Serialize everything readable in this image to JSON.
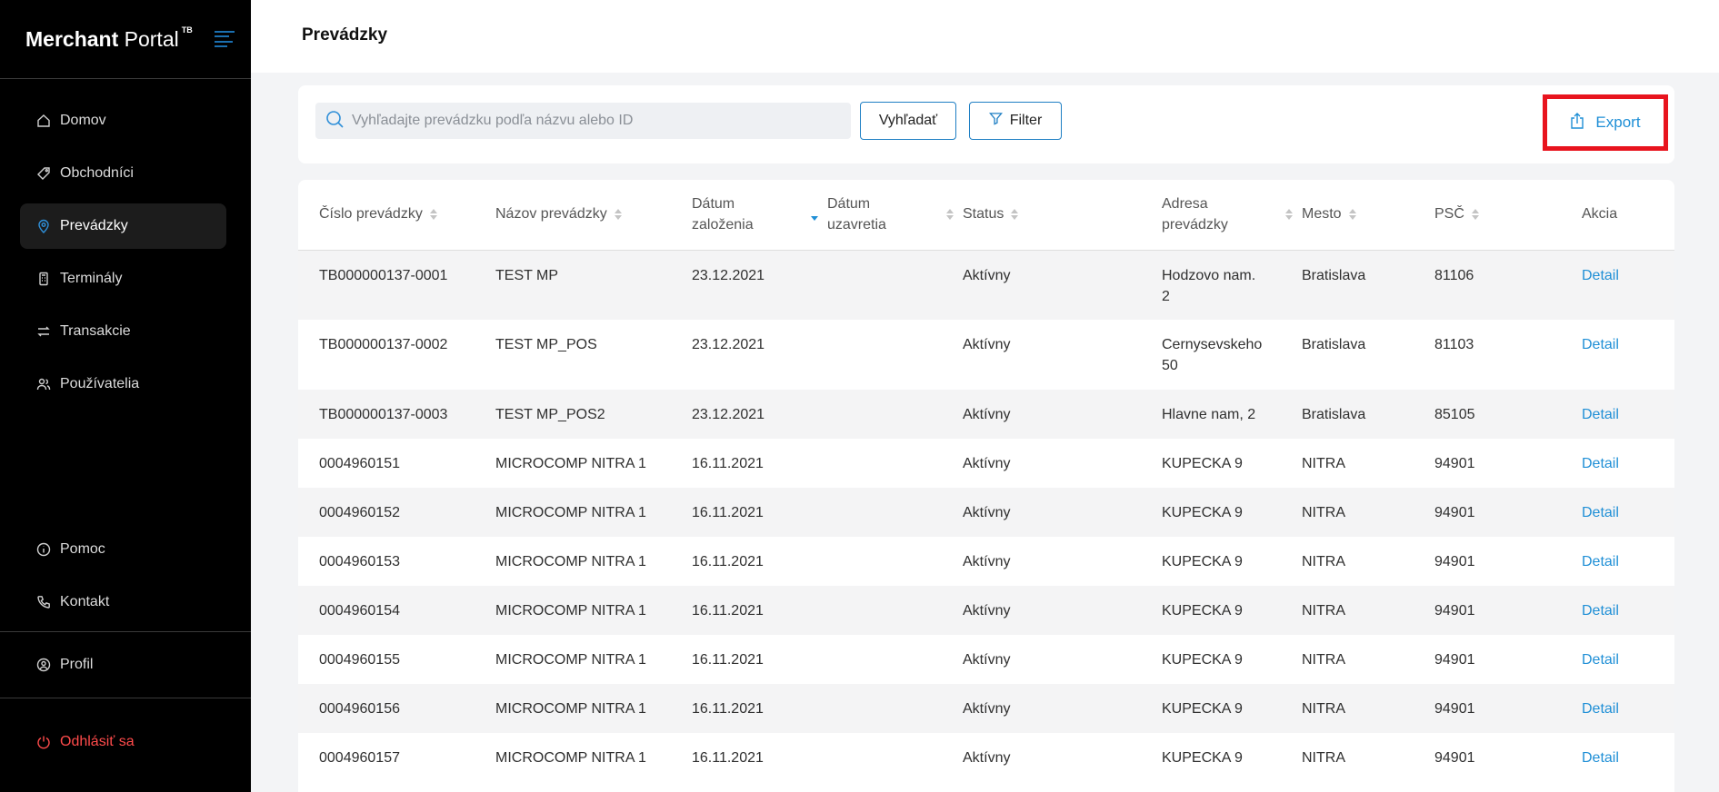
{
  "brand": {
    "bold": "Merchant",
    "rest": "Portal",
    "sup": "TB"
  },
  "nav": {
    "items": [
      {
        "label": "Domov",
        "icon": "home-icon"
      },
      {
        "label": "Obchodníci",
        "icon": "tag-icon"
      },
      {
        "label": "Prevádzky",
        "icon": "location-pin-icon",
        "active": true
      },
      {
        "label": "Terminály",
        "icon": "terminal-icon"
      },
      {
        "label": "Transakcie",
        "icon": "transfer-arrows-icon"
      },
      {
        "label": "Používatelia",
        "icon": "users-icon"
      }
    ],
    "help": "Pomoc",
    "contact": "Kontakt",
    "profile": "Profil",
    "logout": "Odhlásiť sa"
  },
  "page": {
    "title": "Prevádzky"
  },
  "search": {
    "placeholder": "Vyhľadajte prevádzku podľa názvu alebo ID",
    "value": "",
    "search_label": "Vyhľadať",
    "filter_label": "Filter",
    "export_label": "Export"
  },
  "table": {
    "headers": [
      {
        "l1": "Číslo prevádzky",
        "l2": ""
      },
      {
        "l1": "Názov prevádzky",
        "l2": ""
      },
      {
        "l1": "Dátum",
        "l2": "založenia"
      },
      {
        "l1": "Dátum",
        "l2": "uzavretia"
      },
      {
        "l1": "Status",
        "l2": ""
      },
      {
        "l1": "Adresa",
        "l2": "prevádzky"
      },
      {
        "l1": "Mesto",
        "l2": ""
      },
      {
        "l1": "PSČ",
        "l2": ""
      },
      {
        "l1": "Akcia",
        "l2": ""
      }
    ],
    "rows": [
      {
        "id": "TB000000137-0001",
        "name": "TEST MP",
        "created": "23.12.2021",
        "closed": "",
        "status": "Aktívny",
        "addr1": "Hodzovo nam.",
        "addr2": "2",
        "city": "Bratislava",
        "zip": "81106",
        "action": "Detail"
      },
      {
        "id": "TB000000137-0002",
        "name": "TEST MP_POS",
        "created": "23.12.2021",
        "closed": "",
        "status": "Aktívny",
        "addr1": "Cernysevskeho",
        "addr2": "50",
        "city": "Bratislava",
        "zip": "81103",
        "action": "Detail"
      },
      {
        "id": "TB000000137-0003",
        "name": "TEST MP_POS2",
        "created": "23.12.2021",
        "closed": "",
        "status": "Aktívny",
        "addr1": "Hlavne nam, 2",
        "addr2": "",
        "city": "Bratislava",
        "zip": "85105",
        "action": "Detail"
      },
      {
        "id": "0004960151",
        "name": "MICROCOMP NITRA 1",
        "created": "16.11.2021",
        "closed": "",
        "status": "Aktívny",
        "addr1": "KUPECKA 9",
        "addr2": "",
        "city": "NITRA",
        "zip": "94901",
        "action": "Detail"
      },
      {
        "id": "0004960152",
        "name": "MICROCOMP NITRA 1",
        "created": "16.11.2021",
        "closed": "",
        "status": "Aktívny",
        "addr1": "KUPECKA 9",
        "addr2": "",
        "city": "NITRA",
        "zip": "94901",
        "action": "Detail"
      },
      {
        "id": "0004960153",
        "name": "MICROCOMP NITRA 1",
        "created": "16.11.2021",
        "closed": "",
        "status": "Aktívny",
        "addr1": "KUPECKA 9",
        "addr2": "",
        "city": "NITRA",
        "zip": "94901",
        "action": "Detail"
      },
      {
        "id": "0004960154",
        "name": "MICROCOMP NITRA 1",
        "created": "16.11.2021",
        "closed": "",
        "status": "Aktívny",
        "addr1": "KUPECKA 9",
        "addr2": "",
        "city": "NITRA",
        "zip": "94901",
        "action": "Detail"
      },
      {
        "id": "0004960155",
        "name": "MICROCOMP NITRA 1",
        "created": "16.11.2021",
        "closed": "",
        "status": "Aktívny",
        "addr1": "KUPECKA 9",
        "addr2": "",
        "city": "NITRA",
        "zip": "94901",
        "action": "Detail"
      },
      {
        "id": "0004960156",
        "name": "MICROCOMP NITRA 1",
        "created": "16.11.2021",
        "closed": "",
        "status": "Aktívny",
        "addr1": "KUPECKA 9",
        "addr2": "",
        "city": "NITRA",
        "zip": "94901",
        "action": "Detail"
      },
      {
        "id": "0004960157",
        "name": "MICROCOMP NITRA 1",
        "created": "16.11.2021",
        "closed": "",
        "status": "Aktívny",
        "addr1": "KUPECKA 9",
        "addr2": "",
        "city": "NITRA",
        "zip": "94901",
        "action": "Detail"
      }
    ]
  },
  "colors": {
    "accent": "#1f8fd6",
    "sidebar": "#000000",
    "logout": "#ff4b4b",
    "highlight": "#e8141e"
  }
}
